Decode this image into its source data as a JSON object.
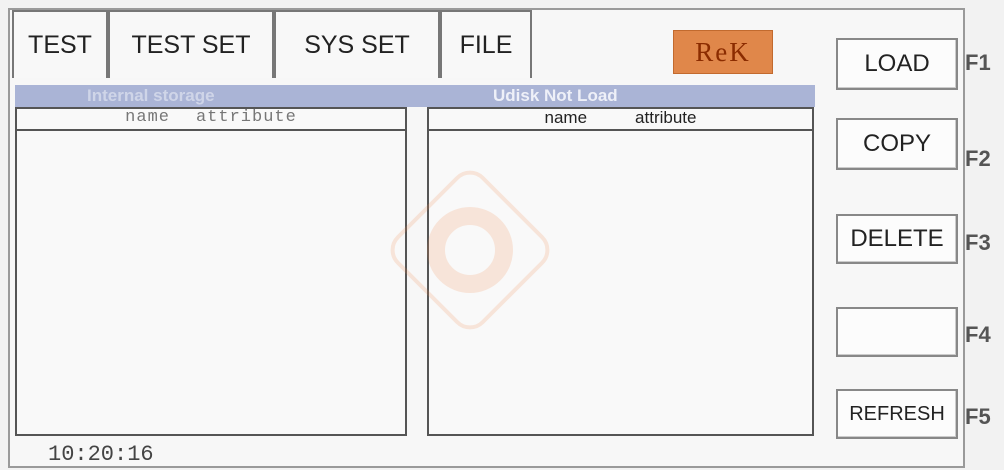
{
  "tabs": [
    {
      "label": "TEST"
    },
    {
      "label": "TEST SET"
    },
    {
      "label": "SYS SET"
    },
    {
      "label": "FILE"
    }
  ],
  "logo": {
    "text": "ReK",
    "color": "#e0874a"
  },
  "storage": {
    "internal_label": "Internal storage",
    "udisk_label": "Udisk Not Load"
  },
  "left_panel": {
    "col_name": "name",
    "col_attr": "attribute"
  },
  "right_panel": {
    "col_name": "name",
    "col_attr": "attribute"
  },
  "function_buttons": [
    {
      "label": "LOAD",
      "key": "F1"
    },
    {
      "label": "COPY",
      "key": "F2"
    },
    {
      "label": "DELETE",
      "key": "F3"
    },
    {
      "label": "",
      "key": "F4"
    },
    {
      "label": "REFRESH",
      "key": "F5"
    }
  ],
  "status": {
    "time": "10:20:16"
  }
}
